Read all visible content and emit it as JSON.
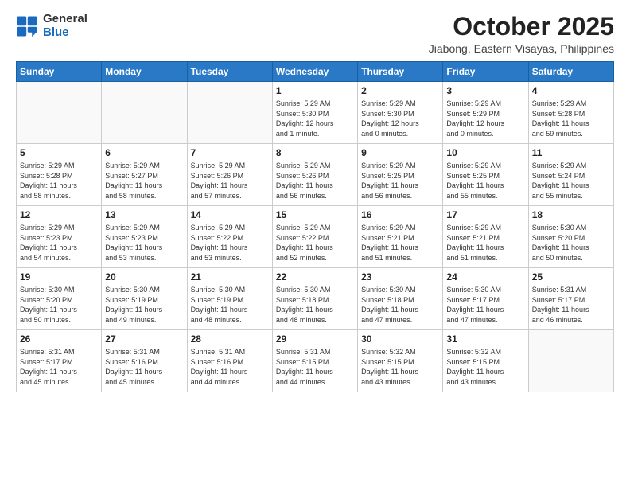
{
  "logo": {
    "general": "General",
    "blue": "Blue"
  },
  "title": "October 2025",
  "location": "Jiabong, Eastern Visayas, Philippines",
  "headers": [
    "Sunday",
    "Monday",
    "Tuesday",
    "Wednesday",
    "Thursday",
    "Friday",
    "Saturday"
  ],
  "weeks": [
    [
      {
        "day": "",
        "info": ""
      },
      {
        "day": "",
        "info": ""
      },
      {
        "day": "",
        "info": ""
      },
      {
        "day": "1",
        "info": "Sunrise: 5:29 AM\nSunset: 5:30 PM\nDaylight: 12 hours\nand 1 minute."
      },
      {
        "day": "2",
        "info": "Sunrise: 5:29 AM\nSunset: 5:30 PM\nDaylight: 12 hours\nand 0 minutes."
      },
      {
        "day": "3",
        "info": "Sunrise: 5:29 AM\nSunset: 5:29 PM\nDaylight: 12 hours\nand 0 minutes."
      },
      {
        "day": "4",
        "info": "Sunrise: 5:29 AM\nSunset: 5:28 PM\nDaylight: 11 hours\nand 59 minutes."
      }
    ],
    [
      {
        "day": "5",
        "info": "Sunrise: 5:29 AM\nSunset: 5:28 PM\nDaylight: 11 hours\nand 58 minutes."
      },
      {
        "day": "6",
        "info": "Sunrise: 5:29 AM\nSunset: 5:27 PM\nDaylight: 11 hours\nand 58 minutes."
      },
      {
        "day": "7",
        "info": "Sunrise: 5:29 AM\nSunset: 5:26 PM\nDaylight: 11 hours\nand 57 minutes."
      },
      {
        "day": "8",
        "info": "Sunrise: 5:29 AM\nSunset: 5:26 PM\nDaylight: 11 hours\nand 56 minutes."
      },
      {
        "day": "9",
        "info": "Sunrise: 5:29 AM\nSunset: 5:25 PM\nDaylight: 11 hours\nand 56 minutes."
      },
      {
        "day": "10",
        "info": "Sunrise: 5:29 AM\nSunset: 5:25 PM\nDaylight: 11 hours\nand 55 minutes."
      },
      {
        "day": "11",
        "info": "Sunrise: 5:29 AM\nSunset: 5:24 PM\nDaylight: 11 hours\nand 55 minutes."
      }
    ],
    [
      {
        "day": "12",
        "info": "Sunrise: 5:29 AM\nSunset: 5:23 PM\nDaylight: 11 hours\nand 54 minutes."
      },
      {
        "day": "13",
        "info": "Sunrise: 5:29 AM\nSunset: 5:23 PM\nDaylight: 11 hours\nand 53 minutes."
      },
      {
        "day": "14",
        "info": "Sunrise: 5:29 AM\nSunset: 5:22 PM\nDaylight: 11 hours\nand 53 minutes."
      },
      {
        "day": "15",
        "info": "Sunrise: 5:29 AM\nSunset: 5:22 PM\nDaylight: 11 hours\nand 52 minutes."
      },
      {
        "day": "16",
        "info": "Sunrise: 5:29 AM\nSunset: 5:21 PM\nDaylight: 11 hours\nand 51 minutes."
      },
      {
        "day": "17",
        "info": "Sunrise: 5:29 AM\nSunset: 5:21 PM\nDaylight: 11 hours\nand 51 minutes."
      },
      {
        "day": "18",
        "info": "Sunrise: 5:30 AM\nSunset: 5:20 PM\nDaylight: 11 hours\nand 50 minutes."
      }
    ],
    [
      {
        "day": "19",
        "info": "Sunrise: 5:30 AM\nSunset: 5:20 PM\nDaylight: 11 hours\nand 50 minutes."
      },
      {
        "day": "20",
        "info": "Sunrise: 5:30 AM\nSunset: 5:19 PM\nDaylight: 11 hours\nand 49 minutes."
      },
      {
        "day": "21",
        "info": "Sunrise: 5:30 AM\nSunset: 5:19 PM\nDaylight: 11 hours\nand 48 minutes."
      },
      {
        "day": "22",
        "info": "Sunrise: 5:30 AM\nSunset: 5:18 PM\nDaylight: 11 hours\nand 48 minutes."
      },
      {
        "day": "23",
        "info": "Sunrise: 5:30 AM\nSunset: 5:18 PM\nDaylight: 11 hours\nand 47 minutes."
      },
      {
        "day": "24",
        "info": "Sunrise: 5:30 AM\nSunset: 5:17 PM\nDaylight: 11 hours\nand 47 minutes."
      },
      {
        "day": "25",
        "info": "Sunrise: 5:31 AM\nSunset: 5:17 PM\nDaylight: 11 hours\nand 46 minutes."
      }
    ],
    [
      {
        "day": "26",
        "info": "Sunrise: 5:31 AM\nSunset: 5:17 PM\nDaylight: 11 hours\nand 45 minutes."
      },
      {
        "day": "27",
        "info": "Sunrise: 5:31 AM\nSunset: 5:16 PM\nDaylight: 11 hours\nand 45 minutes."
      },
      {
        "day": "28",
        "info": "Sunrise: 5:31 AM\nSunset: 5:16 PM\nDaylight: 11 hours\nand 44 minutes."
      },
      {
        "day": "29",
        "info": "Sunrise: 5:31 AM\nSunset: 5:15 PM\nDaylight: 11 hours\nand 44 minutes."
      },
      {
        "day": "30",
        "info": "Sunrise: 5:32 AM\nSunset: 5:15 PM\nDaylight: 11 hours\nand 43 minutes."
      },
      {
        "day": "31",
        "info": "Sunrise: 5:32 AM\nSunset: 5:15 PM\nDaylight: 11 hours\nand 43 minutes."
      },
      {
        "day": "",
        "info": ""
      }
    ]
  ]
}
